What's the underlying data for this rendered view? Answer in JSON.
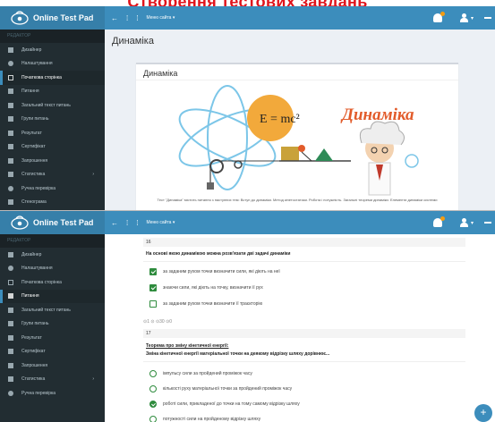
{
  "banner": {
    "title": "Створення тестових завдань"
  },
  "app": {
    "name": "Online Test Pad",
    "nav": {
      "back": "←",
      "item1": "⁞",
      "item2": "⁞",
      "menu_label": "Меню сайта ▾"
    },
    "caret": "▾"
  },
  "sidebar1": {
    "heading": "РЕДАКТОР",
    "items": [
      {
        "label": "Дизайнер"
      },
      {
        "label": "Налаштування"
      },
      {
        "label": "Початкова сторінка"
      },
      {
        "label": "Питання"
      },
      {
        "label": "Загальний текст питань"
      },
      {
        "label": "Групи питань"
      },
      {
        "label": "Результат"
      },
      {
        "label": "Сертифікат"
      },
      {
        "label": "Запрошення"
      },
      {
        "label": "Статистика",
        "caret": "›"
      },
      {
        "label": "Ручна перевірка"
      },
      {
        "label": "Стенограма"
      }
    ]
  },
  "sidebar2": {
    "heading": "РЕДАКТОР",
    "items": [
      {
        "label": "Дизайнер"
      },
      {
        "label": "Налаштування"
      },
      {
        "label": "Початкова сторінка"
      },
      {
        "label": "Питання"
      },
      {
        "label": "Загальний текст питань"
      },
      {
        "label": "Групи питань"
      },
      {
        "label": "Результат"
      },
      {
        "label": "Сертифікат"
      },
      {
        "label": "Запрошення"
      },
      {
        "label": "Статистика",
        "caret": "›"
      },
      {
        "label": "Ручна перевірка"
      }
    ]
  },
  "page1": {
    "title": "Динаміка",
    "box_title": "Динаміка",
    "hero_formula": "E = mc²",
    "hero_word": "Динаміка",
    "description": "Тест \"Динаміка\" містить питання з наступних тем: Вступ до динаміки. Метод кінетостатики. Робота і потужність. Загальні теореми динаміки. Елементи динаміки системи"
  },
  "page2": {
    "q16": {
      "number": "16",
      "text": "На основі якою динамікою можна розв'язати дві задачі динаміки",
      "options": [
        {
          "label": "за заданим рухом точки визначити сили, які діють на неї",
          "checked": true
        },
        {
          "label": "знаючи сили, які діють на точку, визначити її рух",
          "checked": true
        },
        {
          "label": "за заданим рухом точки визначити її траєкторію",
          "checked": false
        }
      ],
      "meta": "⊙1 ⊙ ⊙30 ⊙0"
    },
    "q17": {
      "number": "17",
      "heading": "Теорема про зміну кінетичної енергії:",
      "text": "Зміна кінетичної енергії матеріальної точки на деякому відрізку шляху дорівнює...",
      "options": [
        {
          "label": "імпульсу сили за пройдений проміжок часу",
          "checked": false
        },
        {
          "label": "кількості руху матеріальної точки за пройдений проміжок часу",
          "checked": false
        },
        {
          "label": "роботі сили, прикладеної до точки на тому самому відрізку шляху",
          "checked": true
        },
        {
          "label": "потужності сили на пройденому відрізку шляху",
          "checked": false
        }
      ]
    },
    "fab": "+"
  },
  "colors": {
    "header": "#3c8dbc",
    "logo": "#367fa9",
    "sidebar": "#222d32",
    "accent_green": "#2e8b3d",
    "banner_red": "#e0141c"
  }
}
